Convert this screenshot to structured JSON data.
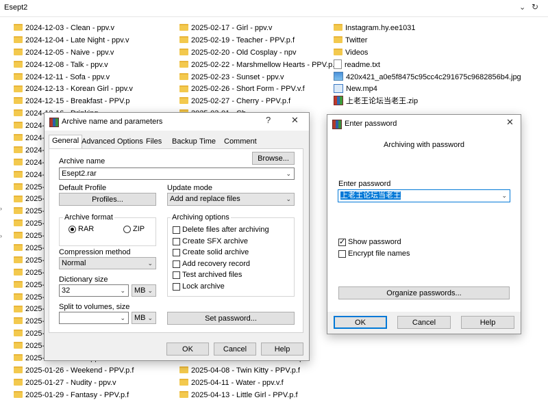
{
  "explorer": {
    "address": "Esept2",
    "col1": [
      "2024-12-03 - Clean - ppv.v",
      "2024-12-04 - Late Night - ppv.v",
      "2024-12-05 - Naive - ppv.v",
      "2024-12-08 - Talk - ppv.v",
      "2024-12-11 - Sofa - ppv.v",
      "2024-12-13 - Korean Girl - ppv.v",
      "2024-12-15 - Breakfast - PPV.p",
      "2024-12-16 - Drinking",
      "2024-1",
      "2024-1",
      "2024-1",
      "2024-1",
      "2024-1",
      "2025-0",
      "2025-0",
      "2025-0",
      "2025-0",
      "2025-0",
      "2025-0",
      "2025-0",
      "2025-0",
      "2025-0",
      "2025-0",
      "2025-0",
      "2025-0",
      "2025-0",
      "2025-0",
      "2025-01-25 - Wet - ppv.v",
      "2025-01-26 - Weekend - PPV.p.f",
      "2025-01-27 - Nudity - ppv.v",
      "2025-01-29 - Fantasy - PPV.p.f"
    ],
    "col2": [
      "2025-02-17 - Girl - ppv.v",
      "2025-02-19 - Teacher - PPV.p.f",
      "2025-02-20 - Old Cosplay - npv",
      "2025-02-22 - Marshmellow Hearts - PPV.p.f",
      "2025-02-23 - Sunset - ppv.v",
      "2025-02-26 - Short Form - PPV.v.f",
      "2025-02-27 - Cherry - PPV.p.f",
      "2025-03-01 - Ch...",
      "",
      "",
      "",
      "",
      "",
      "",
      "",
      "",
      "",
      "",
      "",
      "",
      "",
      "",
      "",
      "",
      "",
      "",
      "",
      "2025-04-06 - Motto Motto - PPV.p.f",
      "2025-04-08 - Twin Kitty - PPV.p.f",
      "2025-04-11 - Water - ppv.v.f",
      "2025-04-13 - Little Girl - PPV.p.f"
    ],
    "col3": [
      {
        "name": "Instagram.hy.ee1031",
        "icon": "folder-icon"
      },
      {
        "name": "Twitter",
        "icon": "folder-icon"
      },
      {
        "name": "Videos",
        "icon": "folder-icon"
      },
      {
        "name": "readme.txt",
        "icon": "text-file-icon"
      },
      {
        "name": "420x421_a0e5f8475c95cc4c291675c9682856b4.jpg",
        "icon": "image-file-icon"
      },
      {
        "name": "New.mp4",
        "icon": "video-file-icon"
      },
      {
        "name": "上老王论坛当老王.zip",
        "icon": "winrar-archive-icon"
      }
    ]
  },
  "archive_dialog": {
    "title": "Archive name and parameters",
    "help_glyph": "?",
    "close_glyph": "✕",
    "tabs": [
      "General",
      "Advanced",
      "Options",
      "Files",
      "Backup",
      "Time",
      "Comment"
    ],
    "archive_name_label": "Archive name",
    "browse": "Browse...",
    "archive_name_value": "Esept2.rar",
    "default_profile_label": "Default Profile",
    "profiles_btn": "Profiles...",
    "update_mode_label": "Update mode",
    "update_mode_value": "Add and replace files",
    "archive_format_label": "Archive format",
    "format_rar": "RAR",
    "format_zip": "ZIP",
    "archiving_options_label": "Archiving options",
    "options": [
      {
        "label": "Delete files after archiving",
        "checked": false
      },
      {
        "label": "Create SFX archive",
        "checked": false
      },
      {
        "label": "Create solid archive",
        "checked": false
      },
      {
        "label": "Add recovery record",
        "checked": false
      },
      {
        "label": "Test archived files",
        "checked": false
      },
      {
        "label": "Lock archive",
        "checked": false
      }
    ],
    "compression_label": "Compression method",
    "compression_value": "Normal",
    "dictionary_label": "Dictionary size",
    "dictionary_value": "32",
    "dictionary_unit": "MB",
    "split_label": "Split to volumes, size",
    "split_value": "",
    "split_unit": "MB",
    "set_password": "Set password...",
    "ok": "OK",
    "cancel": "Cancel",
    "help": "Help"
  },
  "password_dialog": {
    "title": "Enter password",
    "close_glyph": "✕",
    "subtitle": "Archiving with password",
    "enter_label": "Enter password",
    "password_value": "上老王论坛当老王",
    "show_password": "Show password",
    "show_password_checked": true,
    "encrypt_names": "Encrypt file names",
    "encrypt_names_checked": false,
    "organize": "Organize passwords...",
    "ok": "OK",
    "cancel": "Cancel",
    "help": "Help"
  }
}
